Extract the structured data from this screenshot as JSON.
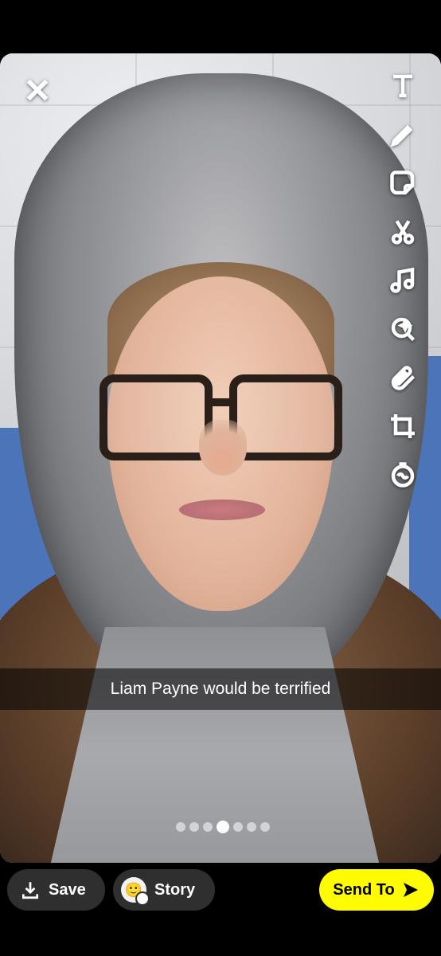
{
  "caption": "Liam Payne would be terrified",
  "bottom_bar": {
    "save_label": "Save",
    "story_label": "Story",
    "send_label": "Send To"
  },
  "tools": [
    "text-icon",
    "pencil-icon",
    "sticker-icon",
    "scissors-icon",
    "music-icon",
    "lens-icon",
    "paperclip-icon",
    "crop-icon",
    "timer-icon"
  ],
  "colors": {
    "send_button": "#fffc00",
    "bar_button": "#2f2f30"
  },
  "pager": {
    "count": 7,
    "active_index": 3
  }
}
